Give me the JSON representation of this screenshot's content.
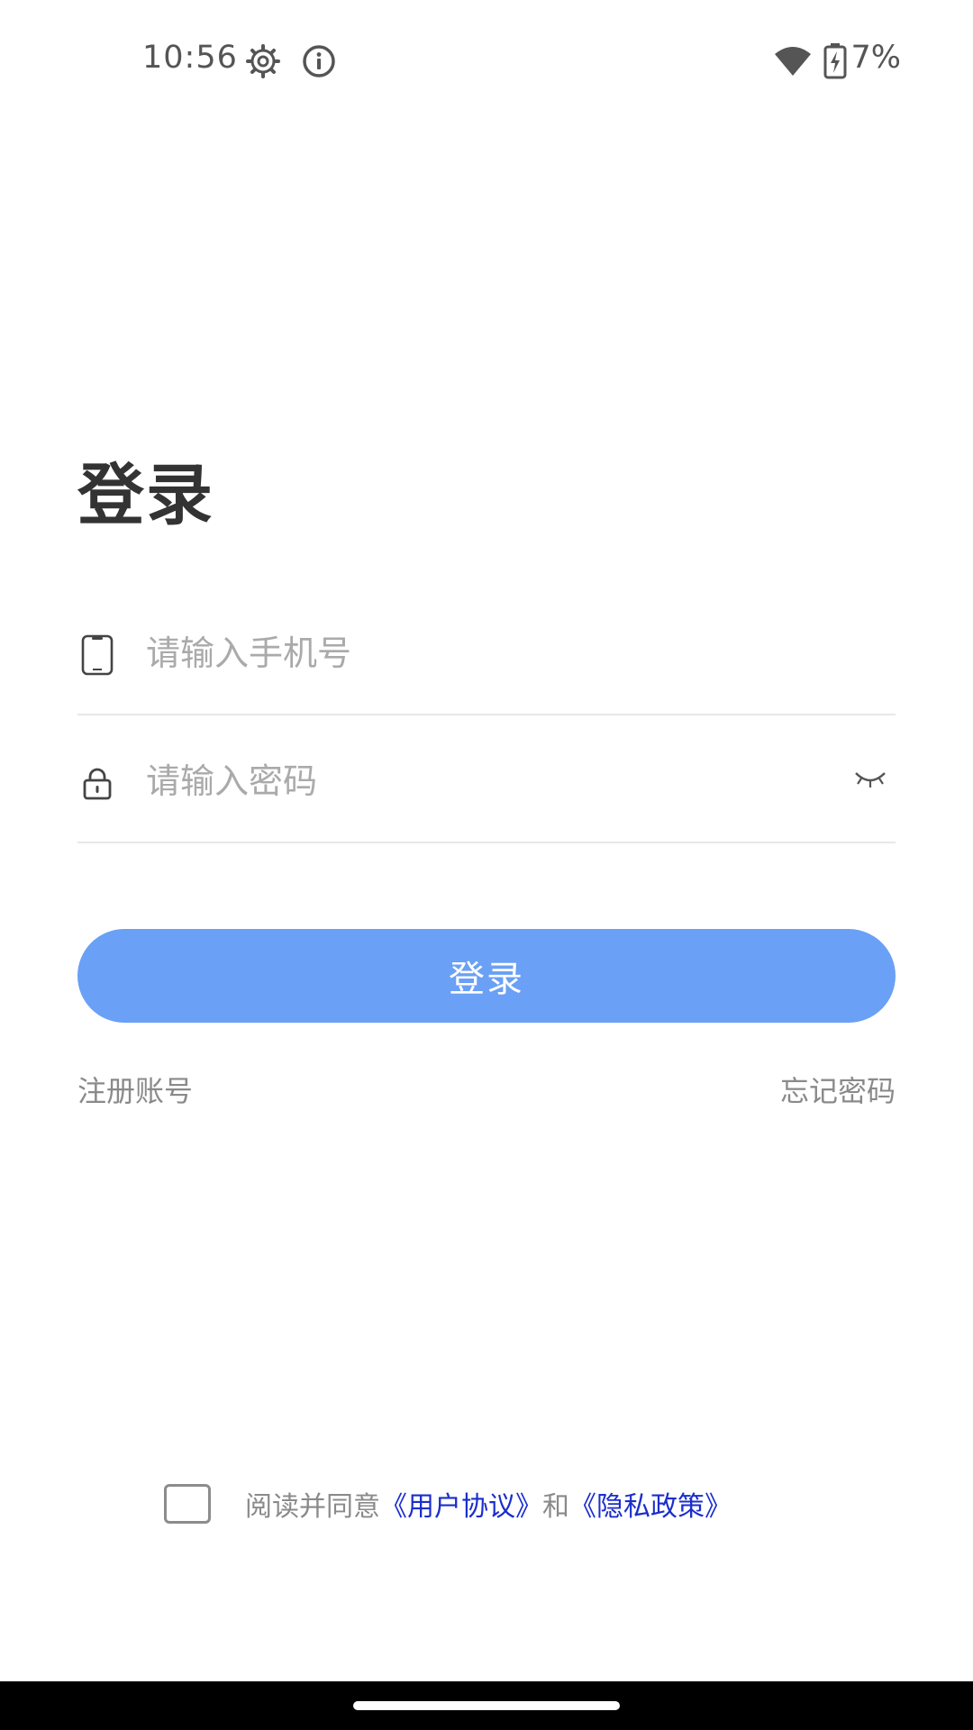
{
  "status_bar": {
    "time": "10:56",
    "icons": [
      "settings-gear-icon",
      "info-icon",
      "wifi-icon",
      "battery-charging-icon"
    ],
    "battery_percent": "7%"
  },
  "title": "登录",
  "phone_field": {
    "placeholder": "请输入手机号",
    "value": "",
    "icon": "phone-icon"
  },
  "password_field": {
    "placeholder": "请输入密码",
    "value": "",
    "icon": "lock-icon",
    "toggle_icon": "eye-closed-icon"
  },
  "login_button_label": "登录",
  "register_label": "注册账号",
  "forgot_password_label": "忘记密码",
  "agreement": {
    "checked": false,
    "prefix": "阅读并同意",
    "user_agreement": "《用户协议》",
    "conjunction": "和",
    "privacy_policy": "《隐私政策》"
  },
  "colors": {
    "primary_button": "#6aa0f5",
    "link": "#1a2ecc",
    "secondary_text": "#8a8a8a"
  }
}
